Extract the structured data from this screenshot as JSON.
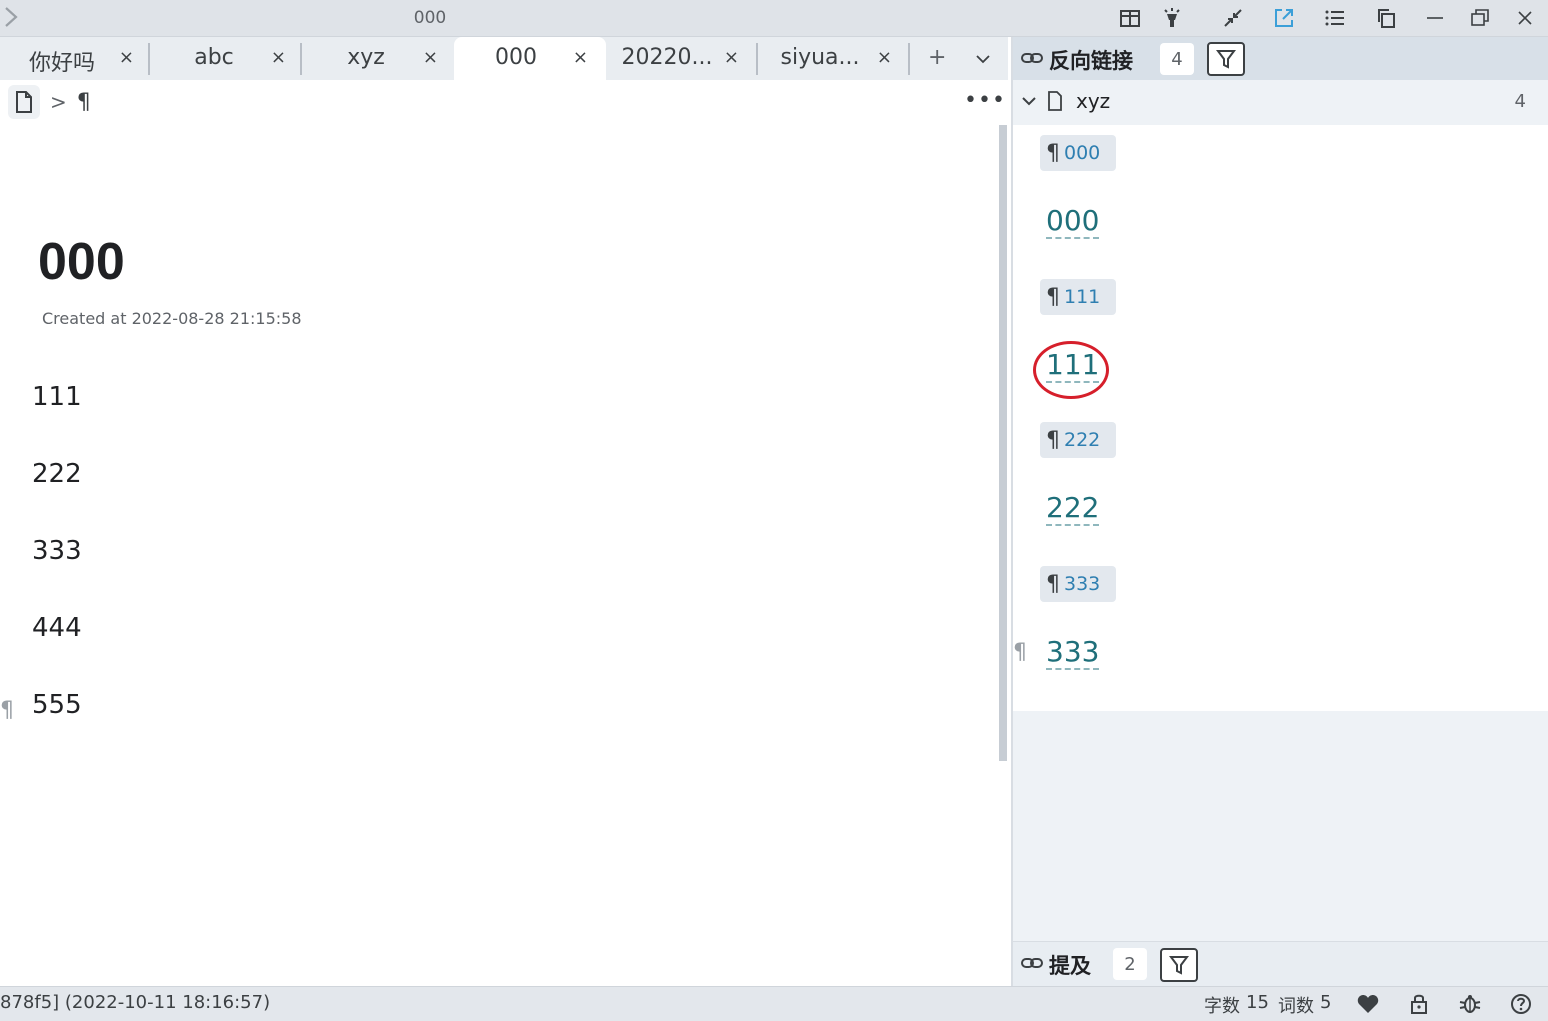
{
  "titlebar": {
    "title": "000",
    "icons": [
      "sidebar-expand-icon",
      "reader-mode-icon",
      "lamp-icon",
      "collapse-icon",
      "open-external-icon",
      "outline-list-icon",
      "copy-icon",
      "minimize-icon",
      "restore-icon",
      "close-icon"
    ]
  },
  "tabs": [
    {
      "label": "你好吗"
    },
    {
      "label": "abc"
    },
    {
      "label": "xyz"
    },
    {
      "label": "000",
      "active": true
    },
    {
      "label": "20220..."
    },
    {
      "label": "siyua..."
    }
  ],
  "tab_close_glyph": "×",
  "tab_actions": {
    "add": "+",
    "dropdown": "⌄"
  },
  "breadcrumb": {
    "separator": ">",
    "paragraph_glyph": "¶"
  },
  "editor": {
    "more_label": "•••",
    "title": "000",
    "created": "Created at 2022-08-28 21:15:58",
    "paragraphs": [
      "111",
      "222",
      "333",
      "444",
      "555"
    ],
    "gutter_glyph": "¶"
  },
  "backlinks": {
    "title": "反向链接",
    "count": "4",
    "doc": {
      "name": "xyz",
      "count": "4"
    },
    "items": [
      {
        "crumb": "000",
        "text": "000"
      },
      {
        "crumb": "111",
        "text": "111"
      },
      {
        "crumb": "222",
        "text": "222"
      },
      {
        "crumb": "333",
        "text": "333"
      }
    ],
    "pilcrow": "¶"
  },
  "mentions": {
    "title": "提及",
    "count": "2"
  },
  "statusbar": {
    "left_text": "878f5] (2022-10-11 18:16:57)",
    "chars_label": "字数",
    "chars_value": "15",
    "words_label": "词数",
    "words_value": "5"
  },
  "colors": {
    "accent": "#3b9fd8",
    "link": "#1f6f7a",
    "highlight": "#d61f2b"
  }
}
